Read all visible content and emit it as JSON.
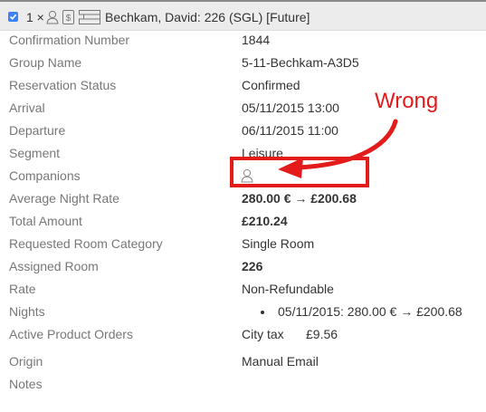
{
  "header": {
    "checked": true,
    "quantity_label": "1 ×",
    "title": "Bechkam, David: 226 (SGL) [Future]",
    "icons": [
      "checkbox-icon",
      "person-icon",
      "price-tag-icon",
      "bed-icon"
    ]
  },
  "fields": [
    {
      "label": "Confirmation Number",
      "value": "1844"
    },
    {
      "label": "Group Name",
      "value": "5-11-Bechkam-A3D5"
    },
    {
      "label": "Reservation Status",
      "value": "Confirmed"
    },
    {
      "label": "Arrival",
      "value": "05/11/2015 13:00"
    },
    {
      "label": "Departure",
      "value": "06/11/2015 11:00"
    },
    {
      "label": "Segment",
      "value": "Leisure"
    },
    {
      "label": "Companions",
      "value_icon": "person-icon"
    },
    {
      "label": "Average Night Rate",
      "value": "280.00 € → £200.68"
    },
    {
      "label": "Total Amount",
      "value": "£210.24"
    },
    {
      "label": "Requested Room Category",
      "value": "Single Room"
    },
    {
      "label": "Assigned Room",
      "value": "226"
    },
    {
      "label": "Rate",
      "value": "Non-Refundable"
    },
    {
      "label": "Nights",
      "value": "05/11/2015: 280.00 € → £200.68"
    },
    {
      "label": "Active Product Orders",
      "value": "City tax",
      "value2": "£9.56"
    },
    {
      "label": "Origin",
      "value": "Manual Email"
    },
    {
      "label": "Notes",
      "value": ""
    }
  ],
  "annotation": {
    "text": "Wrong",
    "color": "#e41b1b"
  },
  "colors": {
    "label": "#777777",
    "value": "#333333",
    "header_bg": "#ececec",
    "checkbox": "#3b82f6"
  }
}
